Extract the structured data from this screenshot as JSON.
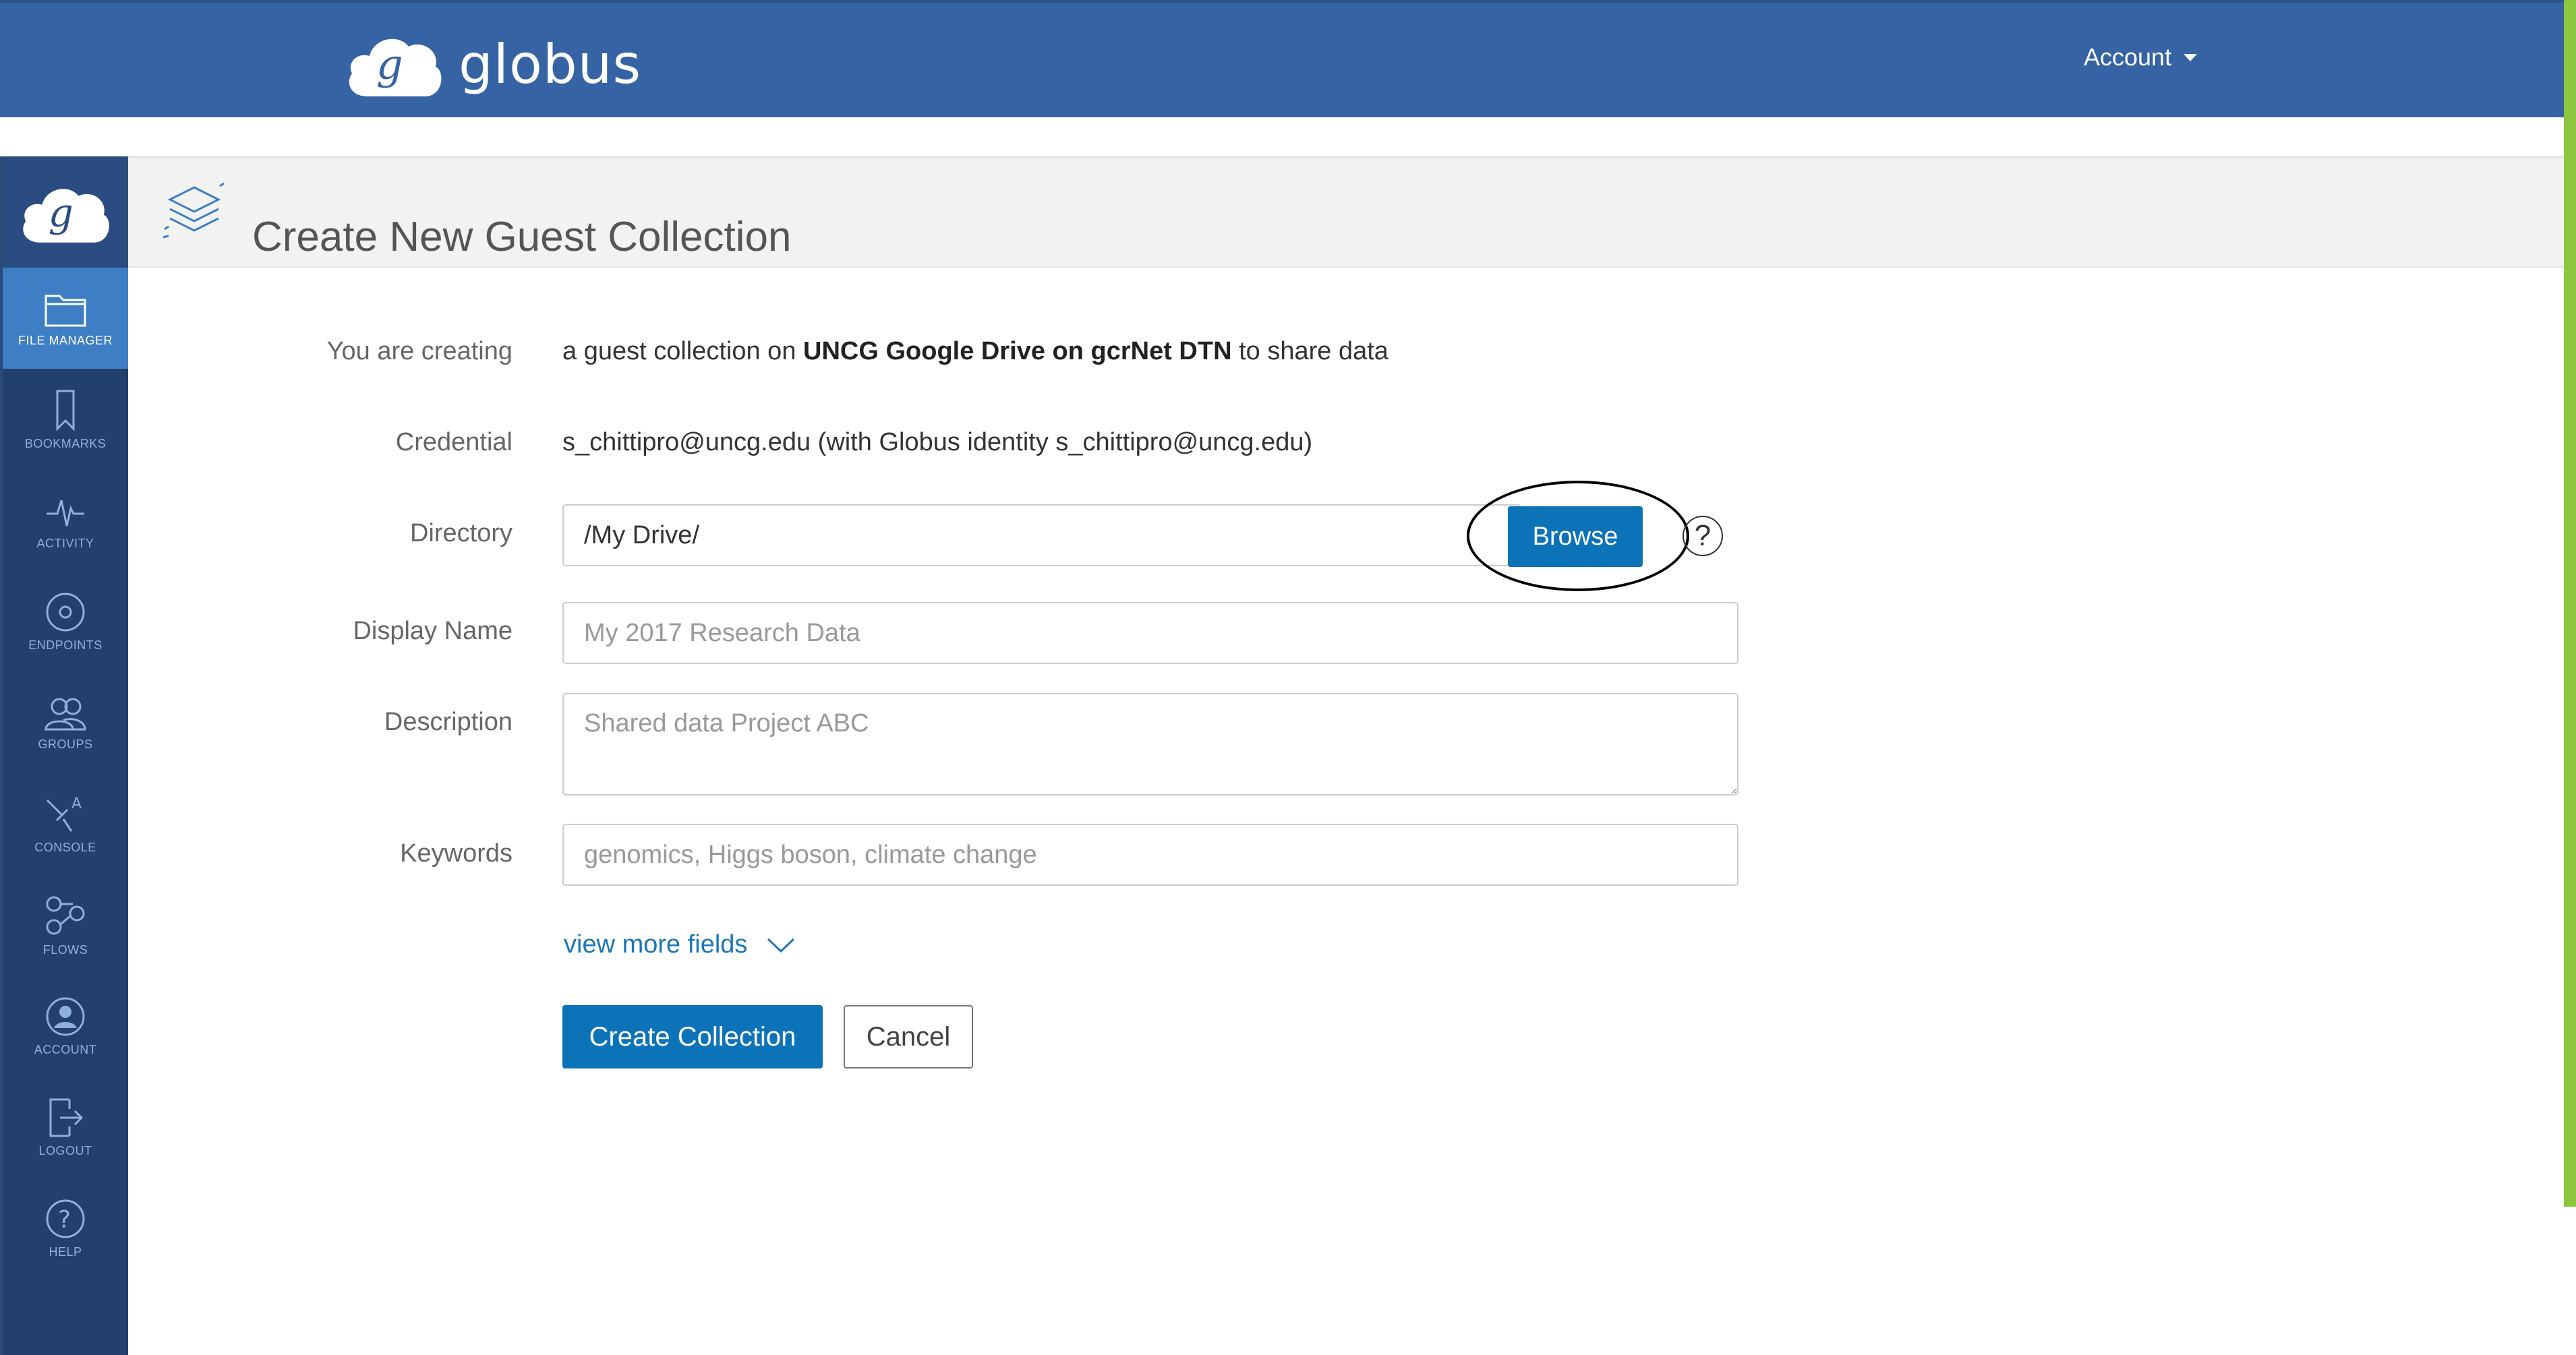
{
  "app": {
    "brand_name": "globus",
    "account_menu_label": "Account",
    "accent_color": "#3563a3",
    "primary_button_color": "#0c73b8"
  },
  "sidebar": {
    "items": [
      {
        "label": "FILE MANAGER",
        "icon": "folder-icon",
        "active": true
      },
      {
        "label": "BOOKMARKS",
        "icon": "bookmark-icon"
      },
      {
        "label": "ACTIVITY",
        "icon": "activity-icon"
      },
      {
        "label": "ENDPOINTS",
        "icon": "endpoint-icon"
      },
      {
        "label": "GROUPS",
        "icon": "groups-icon"
      },
      {
        "label": "CONSOLE",
        "icon": "console-icon"
      },
      {
        "label": "FLOWS",
        "icon": "flows-icon"
      },
      {
        "label": "ACCOUNT",
        "icon": "account-icon"
      },
      {
        "label": "LOGOUT",
        "icon": "logout-icon"
      },
      {
        "label": "HELP",
        "icon": "help-icon"
      }
    ]
  },
  "page": {
    "title": "Create New Guest Collection"
  },
  "form": {
    "creating_label": "You are creating",
    "creating_prefix": "a guest collection on",
    "creating_endpoint": "UNCG Google Drive on gcrNet DTN",
    "creating_suffix": "to share data",
    "credential_label": "Credential",
    "credential_value": "s_chittipro@uncg.edu (with Globus identity s_chittipro@uncg.edu)",
    "directory_label": "Directory",
    "directory_value": "/My Drive/",
    "browse_label": "Browse",
    "help_symbol": "?",
    "display_name_label": "Display Name",
    "display_name_placeholder": "My 2017 Research Data",
    "description_label": "Description",
    "description_placeholder": "Shared data Project ABC",
    "keywords_label": "Keywords",
    "keywords_placeholder": "genomics, Higgs boson, climate change",
    "view_more_label": "view more fields",
    "create_label": "Create Collection",
    "cancel_label": "Cancel"
  }
}
